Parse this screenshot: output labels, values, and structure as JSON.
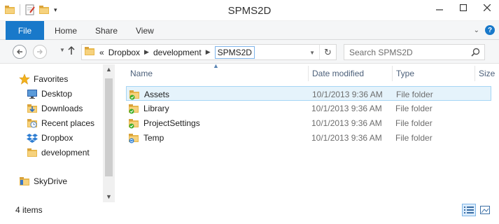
{
  "window": {
    "title": "SPMS2D"
  },
  "ribbon": {
    "tabs": [
      {
        "label": "File"
      },
      {
        "label": "Home"
      },
      {
        "label": "Share"
      },
      {
        "label": "View"
      }
    ]
  },
  "address": {
    "overflow_marker": "«",
    "crumbs": [
      "Dropbox",
      "development"
    ],
    "current": "SPMS2D"
  },
  "search": {
    "placeholder": "Search SPMS2D"
  },
  "nav": {
    "favorites_label": "Favorites",
    "items": [
      {
        "label": "Desktop",
        "icon": "desktop-icon"
      },
      {
        "label": "Downloads",
        "icon": "downloads-folder-icon"
      },
      {
        "label": "Recent places",
        "icon": "recent-places-icon"
      },
      {
        "label": "Dropbox",
        "icon": "dropbox-icon"
      },
      {
        "label": "development",
        "icon": "folder-icon"
      }
    ],
    "skydrive_label": "SkyDrive"
  },
  "columns": {
    "name": "Name",
    "date": "Date modified",
    "type": "Type",
    "size": "Size"
  },
  "files": [
    {
      "name": "Assets",
      "date": "10/1/2013 9:36 AM",
      "type": "File folder",
      "badge": "synced-check-icon",
      "selected": true
    },
    {
      "name": "Library",
      "date": "10/1/2013 9:36 AM",
      "type": "File folder",
      "badge": "synced-check-icon",
      "selected": false
    },
    {
      "name": "ProjectSettings",
      "date": "10/1/2013 9:36 AM",
      "type": "File folder",
      "badge": "synced-check-icon",
      "selected": false
    },
    {
      "name": "Temp",
      "date": "10/1/2013 9:36 AM",
      "type": "File folder",
      "badge": "syncing-icon",
      "selected": false
    }
  ],
  "status": {
    "item_count": "4 items"
  },
  "colors": {
    "accent": "#1979ca",
    "folder": "#e8b74a",
    "selection": "#e5f3fb",
    "sync_green": "#3fae2a",
    "sync_blue": "#2c7fd6"
  }
}
